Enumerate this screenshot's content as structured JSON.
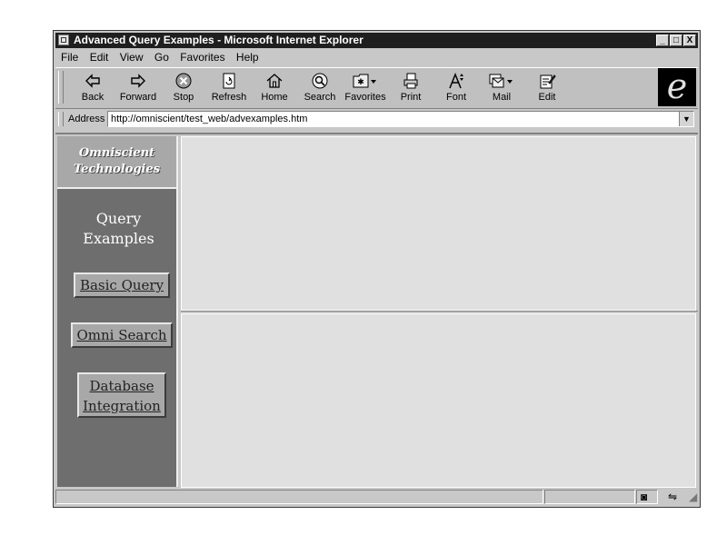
{
  "window": {
    "title": "Advanced Query Examples - Microsoft Internet Explorer",
    "controls": [
      "_",
      "□",
      "X"
    ]
  },
  "menu": [
    "File",
    "Edit",
    "View",
    "Go",
    "Favorites",
    "Help"
  ],
  "toolbar": {
    "buttons": [
      {
        "label": "Back",
        "icon": "back-arrow-icon"
      },
      {
        "label": "Forward",
        "icon": "forward-arrow-icon"
      },
      {
        "label": "Stop",
        "icon": "stop-icon"
      },
      {
        "label": "Refresh",
        "icon": "refresh-icon"
      },
      {
        "label": "Home",
        "icon": "home-icon"
      },
      {
        "label": "Search",
        "icon": "search-icon"
      },
      {
        "label": "Favorites",
        "icon": "favorites-icon"
      },
      {
        "label": "Print",
        "icon": "print-icon"
      },
      {
        "label": "Font",
        "icon": "font-icon"
      },
      {
        "label": "Mail",
        "icon": "mail-icon"
      },
      {
        "label": "Edit",
        "icon": "edit-icon"
      }
    ]
  },
  "address": {
    "label": "Address",
    "url": "http://omniscient/test_web/advexamples.htm"
  },
  "sidebar": {
    "logo_line1": "Omniscient",
    "logo_line2": "Technologies",
    "heading_line1": "Query",
    "heading_line2": "Examples",
    "nav": [
      {
        "line1": "Basic Query",
        "line2": ""
      },
      {
        "line1": "Omni Search",
        "line2": ""
      },
      {
        "line1": "Database",
        "line2": "Integration"
      }
    ]
  },
  "colors": {
    "titlebar": "#1f1f1f",
    "sidebar": "#6e6e6e",
    "frame": "#e0e0e0"
  }
}
